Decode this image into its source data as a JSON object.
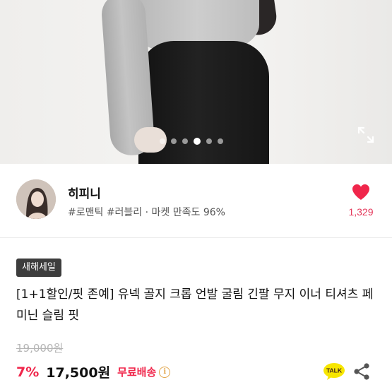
{
  "product_image": {
    "alt": "",
    "carousel": {
      "count": 6,
      "active_index": 3
    },
    "expand_icon": "expand-icon"
  },
  "seller": {
    "name": "히피니",
    "tags": "#로맨틱 #러블리 · 마켓 만족도 96%",
    "like_count": "1,329",
    "colors": {
      "heart": "#f0264b",
      "count": "#e4375a"
    }
  },
  "product": {
    "badge": "새해세일",
    "title": "[1+1할인/핏 존예] 유넥 골지 크롭 언발 굴림 긴팔 무지 이너 티셔츠 페미닌 슬림 핏",
    "original_price": "19,000원",
    "discount": "7%",
    "price": "17,500원",
    "shipping": "무료배송",
    "colors": {
      "accent": "#f0264b",
      "badge_bg": "#3d3d3d"
    }
  },
  "actions": {
    "talk_label": "TALK",
    "share_icon": "share-icon"
  }
}
